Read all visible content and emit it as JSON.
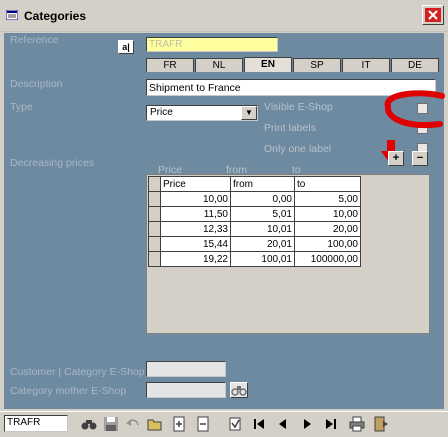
{
  "window": {
    "title": "Categories",
    "close_label": "X"
  },
  "labels": {
    "reference": "Reference",
    "description": "Description",
    "type": "Type",
    "visible_eshop": "Visible E-Shop",
    "print_labels": "Print labels",
    "only_one_label": "Only one label",
    "decreasing_prices": "Decreasing prices",
    "col_price": "Price",
    "col_from": "from",
    "col_to": "to",
    "customer_category": "Customer | Category E-Shop",
    "category_mother": "Category mother E-Shop"
  },
  "reference": {
    "lookup_icon": "a|",
    "value": "TRAFR"
  },
  "language_tabs": [
    "FR",
    "NL",
    "EN",
    "SP",
    "IT",
    "DE"
  ],
  "active_tab": "EN",
  "description": {
    "value": "Shipment to France"
  },
  "type_select": {
    "value": "Price",
    "arrow": "▼"
  },
  "buttons": {
    "add": "+",
    "remove": "−"
  },
  "grid": {
    "headers": [
      "Price",
      "from",
      "to"
    ],
    "rows": [
      [
        "10,00",
        "0,00",
        "5,00"
      ],
      [
        "11,50",
        "5,01",
        "10,00"
      ],
      [
        "12,33",
        "10,01",
        "20,00"
      ],
      [
        "15,44",
        "20,01",
        "100,00"
      ],
      [
        "19,22",
        "100,01",
        "100000,00"
      ]
    ]
  },
  "toolbar": {
    "record_field": "TRAFR",
    "icons": [
      "binoculars-icon",
      "save-icon",
      "undo-icon",
      "open-folder-icon",
      "new-record-icon",
      "copy-record-icon",
      "delete-record-icon",
      "first-record-icon",
      "previous-record-icon",
      "next-record-icon",
      "last-record-icon",
      "print-icon",
      "exit-icon"
    ]
  },
  "annotation_color": "#e00000",
  "client_color": "#6d8aa0"
}
